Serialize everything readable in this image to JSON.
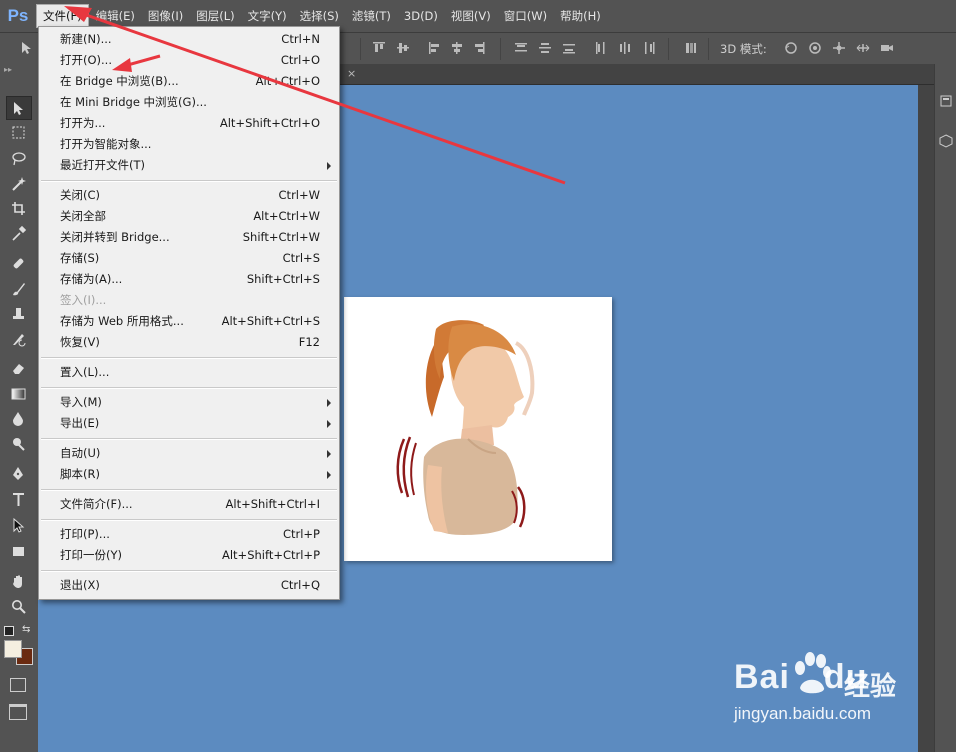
{
  "app": {
    "logo": "Ps"
  },
  "menubar": {
    "items": [
      "文件(F)",
      "编辑(E)",
      "图像(I)",
      "图层(L)",
      "文字(Y)",
      "选择(S)",
      "滤镜(T)",
      "3D(D)",
      "视图(V)",
      "窗口(W)",
      "帮助(H)"
    ],
    "active_index": 0
  },
  "optionsbar": {
    "mode_label": "3D 模式:"
  },
  "file_menu": {
    "items": [
      {
        "label": "新建(N)...",
        "shortcut": "Ctrl+N"
      },
      {
        "label": "打开(O)...",
        "shortcut": "Ctrl+O"
      },
      {
        "label": "在 Bridge 中浏览(B)...",
        "shortcut": "Alt+Ctrl+O"
      },
      {
        "label": "在 Mini Bridge 中浏览(G)...",
        "shortcut": ""
      },
      {
        "label": "打开为...",
        "shortcut": "Alt+Shift+Ctrl+O"
      },
      {
        "label": "打开为智能对象...",
        "shortcut": ""
      },
      {
        "label": "最近打开文件(T)",
        "shortcut": "",
        "submenu": true
      },
      {
        "separator": true
      },
      {
        "label": "关闭(C)",
        "shortcut": "Ctrl+W"
      },
      {
        "label": "关闭全部",
        "shortcut": "Alt+Ctrl+W"
      },
      {
        "label": "关闭并转到 Bridge...",
        "shortcut": "Shift+Ctrl+W"
      },
      {
        "label": "存储(S)",
        "shortcut": "Ctrl+S"
      },
      {
        "label": "存储为(A)...",
        "shortcut": "Shift+Ctrl+S"
      },
      {
        "label": "签入(I)...",
        "shortcut": "",
        "disabled": true
      },
      {
        "label": "存储为 Web 所用格式...",
        "shortcut": "Alt+Shift+Ctrl+S"
      },
      {
        "label": "恢复(V)",
        "shortcut": "F12"
      },
      {
        "separator": true
      },
      {
        "label": "置入(L)...",
        "shortcut": ""
      },
      {
        "separator": true
      },
      {
        "label": "导入(M)",
        "shortcut": "",
        "submenu": true
      },
      {
        "label": "导出(E)",
        "shortcut": "",
        "submenu": true
      },
      {
        "separator": true
      },
      {
        "label": "自动(U)",
        "shortcut": "",
        "submenu": true
      },
      {
        "label": "脚本(R)",
        "shortcut": "",
        "submenu": true
      },
      {
        "separator": true
      },
      {
        "label": "文件简介(F)...",
        "shortcut": "Alt+Shift+Ctrl+I"
      },
      {
        "separator": true
      },
      {
        "label": "打印(P)...",
        "shortcut": "Ctrl+P"
      },
      {
        "label": "打印一份(Y)",
        "shortcut": "Alt+Shift+Ctrl+P"
      },
      {
        "separator": true
      },
      {
        "label": "退出(X)",
        "shortcut": "Ctrl+Q"
      }
    ]
  },
  "tools": [
    "move-tool-icon",
    "marquee-tool-icon",
    "lasso-tool-icon",
    "magic-wand-icon",
    "crop-tool-icon",
    "eyedropper-icon",
    "healing-brush-icon",
    "brush-tool-icon",
    "clone-stamp-icon",
    "history-brush-icon",
    "eraser-icon",
    "gradient-tool-icon",
    "blur-tool-icon",
    "dodge-tool-icon",
    "pen-tool-icon",
    "type-tool-icon",
    "path-select-icon",
    "shape-tool-icon",
    "hand-tool-icon",
    "zoom-tool-icon"
  ],
  "colors": {
    "canvas_bg": "#5c8bc0",
    "annotation": "#e8373f",
    "foreground_swatch": "#f5efe0",
    "background_swatch": "#6a2a10"
  },
  "watermark": {
    "brand": "Bai",
    "brand2": "du",
    "cn": "经验",
    "url": "jingyan.baidu.com"
  }
}
